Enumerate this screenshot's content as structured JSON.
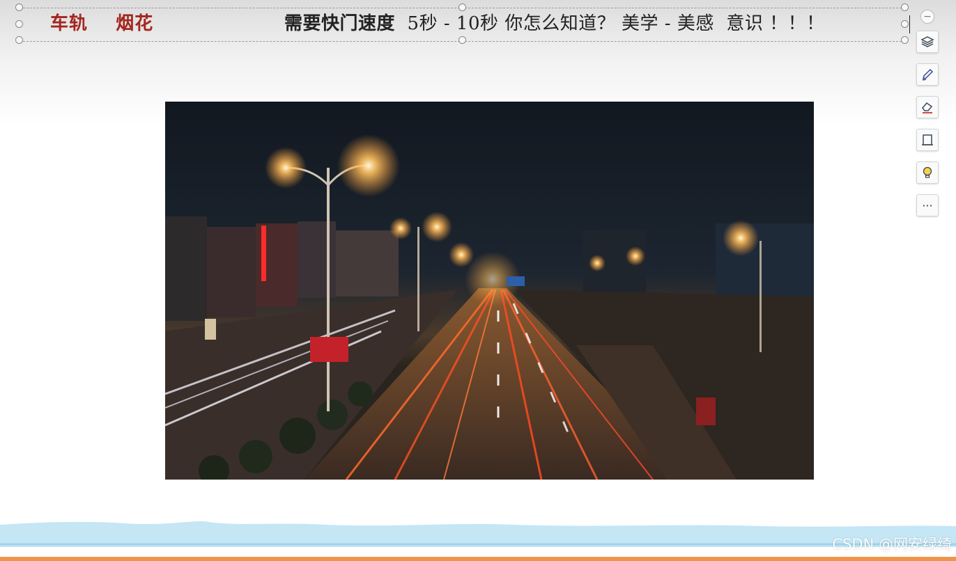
{
  "slide": {
    "title_left": "车轨    烟花",
    "title_bold": "需要快门速度",
    "title_rest": "  5秒 - 10秒 你怎么知道？ 美学 - 美感  意识 ！！！"
  },
  "photo": {
    "subject": "night-highway-light-trails"
  },
  "toolbar": {
    "collapse_glyph": "−",
    "more_glyph": "···",
    "icons": [
      "layers-icon",
      "pen-icon",
      "eraser-icon",
      "frame-icon",
      "bulb-icon",
      "more-icon"
    ]
  },
  "watermark": "CSDN @网安绿绮",
  "colors": {
    "title_red": "#a3261f",
    "wave_blue": "#bfe3f3",
    "bottom_orange": "#f0944a"
  }
}
